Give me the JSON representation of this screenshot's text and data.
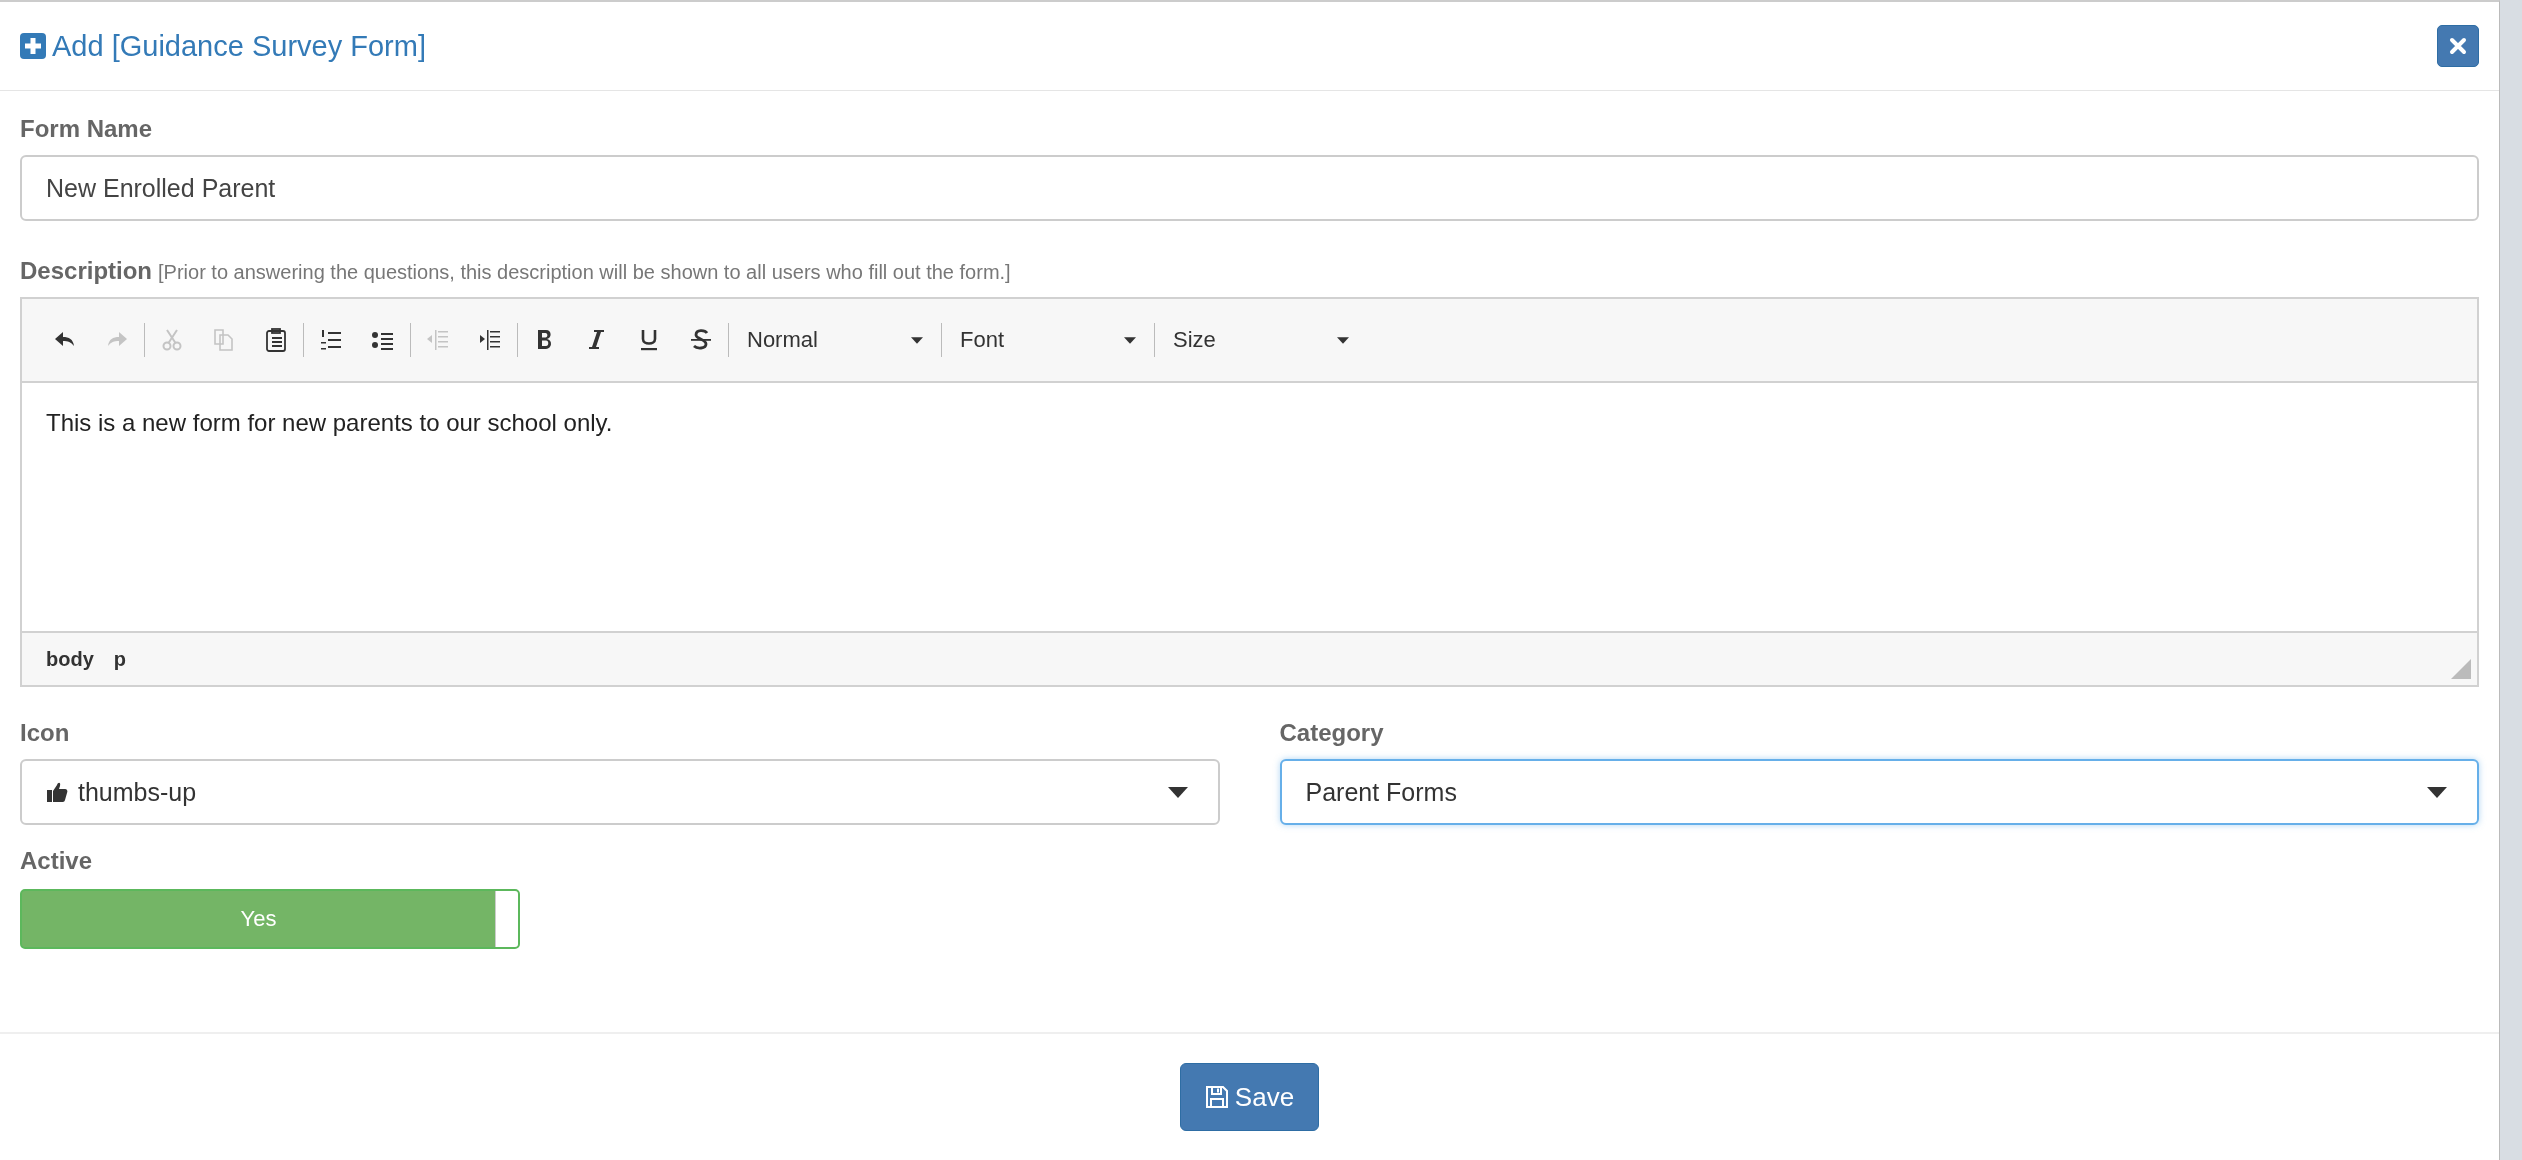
{
  "dialog": {
    "title": "Add [Guidance Survey Form]"
  },
  "form_name": {
    "label": "Form Name",
    "value": "New Enrolled Parent"
  },
  "description": {
    "label": "Description",
    "hint": "[Prior to answering the questions, this description will be shown to all users who fill out the form.]",
    "toolbar": [
      [
        {
          "kind": "undo",
          "disabled": false
        },
        {
          "kind": "redo",
          "disabled": true
        }
      ],
      [
        {
          "kind": "cut",
          "disabled": true
        },
        {
          "kind": "copy",
          "disabled": true
        },
        {
          "kind": "paste",
          "disabled": false
        }
      ],
      [
        {
          "kind": "numbered",
          "disabled": false
        },
        {
          "kind": "bulleted",
          "disabled": false
        }
      ],
      [
        {
          "kind": "outdent",
          "disabled": true
        },
        {
          "kind": "indent",
          "disabled": false
        }
      ],
      [
        {
          "kind": "bold",
          "disabled": false
        },
        {
          "kind": "italic",
          "disabled": false
        },
        {
          "kind": "underline",
          "disabled": false
        },
        {
          "kind": "strike",
          "disabled": false
        }
      ],
      [
        {
          "kind": "dropdown",
          "value": "Normal"
        }
      ],
      [
        {
          "kind": "dropdown",
          "value": "Font"
        }
      ],
      [
        {
          "kind": "dropdown",
          "value": "Size"
        }
      ]
    ],
    "content": "This is a new form for new parents to our school only.",
    "path": [
      "body",
      "p"
    ]
  },
  "icon": {
    "label": "Icon",
    "value": "thumbs-up",
    "focused": false
  },
  "category": {
    "label": "Category",
    "value": "Parent Forms",
    "focused": true
  },
  "active": {
    "label": "Active",
    "on": true,
    "text": "Yes"
  },
  "save_button": "Save"
}
